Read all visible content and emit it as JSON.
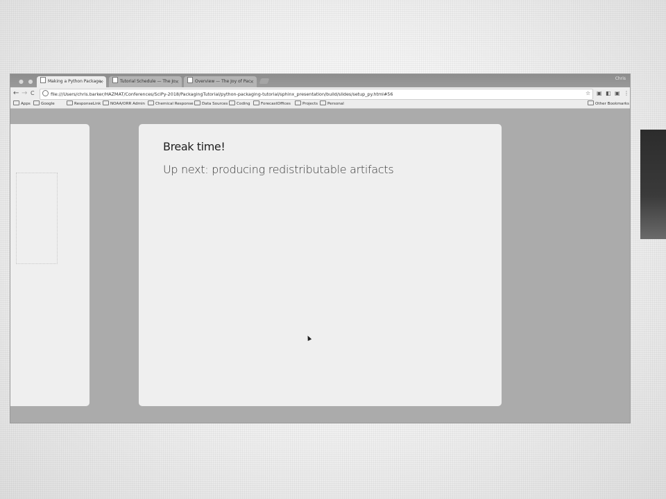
{
  "tabs": [
    {
      "title": "Making a Python Package — T",
      "active": true
    },
    {
      "title": "Tutorial Schedule — The Joy",
      "active": false
    },
    {
      "title": "Overview — The Joy of Packa",
      "active": false
    }
  ],
  "tab_close": "×",
  "user_label": "Chris",
  "nav": {
    "back": "←",
    "forward": "→",
    "reload": "C"
  },
  "url": "file:///Users/chris.barker/HAZMAT/Conferences/SciPy-2018/PackagingTutorial/python-packaging-tutorial/sphinx_presentation/build/slides/setup_py.html#56",
  "toolbar_icons": {
    "star": "☆",
    "ext1": "▣",
    "ext2": "◧",
    "menu": "⋮"
  },
  "bookmarks": [
    {
      "label": "Apps",
      "icon": "apps-icon"
    },
    {
      "label": "Google",
      "icon": "folder-icon"
    },
    {
      "label": "ResponseLink",
      "icon": "folder-icon"
    },
    {
      "label": "NOAA/ORR Admin",
      "icon": "folder-icon"
    },
    {
      "label": "Chemical Response",
      "icon": "folder-icon"
    },
    {
      "label": "Data Sources",
      "icon": "folder-icon"
    },
    {
      "label": "Coding",
      "icon": "folder-icon"
    },
    {
      "label": "ForecastOffices",
      "icon": "folder-icon"
    },
    {
      "label": "Projects",
      "icon": "folder-icon"
    },
    {
      "label": "Personal",
      "icon": "folder-icon"
    }
  ],
  "other_bookmarks": "Other Bookmarks",
  "slide": {
    "title": "Break time!",
    "subtitle": "Up next: producing redistributable artifacts"
  }
}
